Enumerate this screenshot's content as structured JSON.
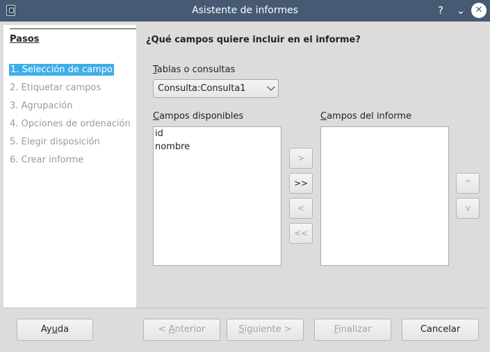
{
  "window": {
    "title": "Asistente de informes"
  },
  "titlebar": {
    "help_glyph": "?",
    "minimize_glyph": "⌄",
    "close_glyph": "✕"
  },
  "steps": {
    "header": "Pasos",
    "items": [
      {
        "label": "1. Selección de campo",
        "state": "active"
      },
      {
        "label": "2. Etiquetar campos",
        "state": "disabled"
      },
      {
        "label": "3. Agrupación",
        "state": "disabled"
      },
      {
        "label": "4. Opciones de ordenación",
        "state": "disabled"
      },
      {
        "label": "5. Elegir disposición",
        "state": "disabled"
      },
      {
        "label": "6. Crear informe",
        "state": "disabled"
      }
    ]
  },
  "main": {
    "question": "¿Qué campos quiere incluir en el informe?",
    "tables_label_accel": "T",
    "tables_label_rest": "ablas o consultas",
    "tables_selected": "Consulta:Consulta1",
    "available_label_accel": "C",
    "available_label_rest": "ampos disponibles",
    "available_fields": [
      "id",
      "nombre"
    ],
    "report_label_accel": "C",
    "report_label_rest": "ampos del informe",
    "report_fields": []
  },
  "move_buttons": {
    "add": ">",
    "add_all": ">>",
    "remove": "<",
    "remove_all": "<<",
    "up": "^",
    "down": "v"
  },
  "footer": {
    "help_pre": "Ay",
    "help_accel": "u",
    "help_post": "da",
    "back_pre": "< ",
    "back_accel": "A",
    "back_post": "nterior",
    "next_accel": "S",
    "next_post": "iguiente >",
    "finish_accel": "F",
    "finish_post": "inalizar",
    "cancel": "Cancelar"
  },
  "colors": {
    "titlebar": "#465a73",
    "selection": "#3daee9",
    "dialog_bg": "#dedcdb"
  }
}
